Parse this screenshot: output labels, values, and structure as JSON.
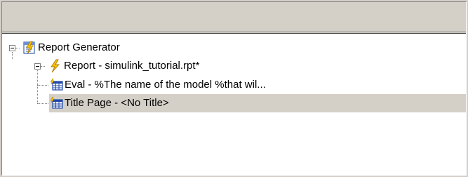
{
  "tree": {
    "root": {
      "label": "Report Generator",
      "icon": "report-generator-icon"
    },
    "report": {
      "label": "Report - simulink_tutorial.rpt*",
      "icon": "lightning-bolt-icon"
    },
    "children": [
      {
        "label": "Eval - %The name of the model %that wil...",
        "icon": "component-grid-icon"
      },
      {
        "label": "Title Page - <No Title>",
        "icon": "component-grid-icon",
        "selected": true
      }
    ]
  },
  "colors": {
    "window_bg": "#d4d0c8",
    "tree_bg": "#ffffff",
    "selection_bg": "#d4d0c8",
    "bolt_yellow": "#f5c400"
  }
}
